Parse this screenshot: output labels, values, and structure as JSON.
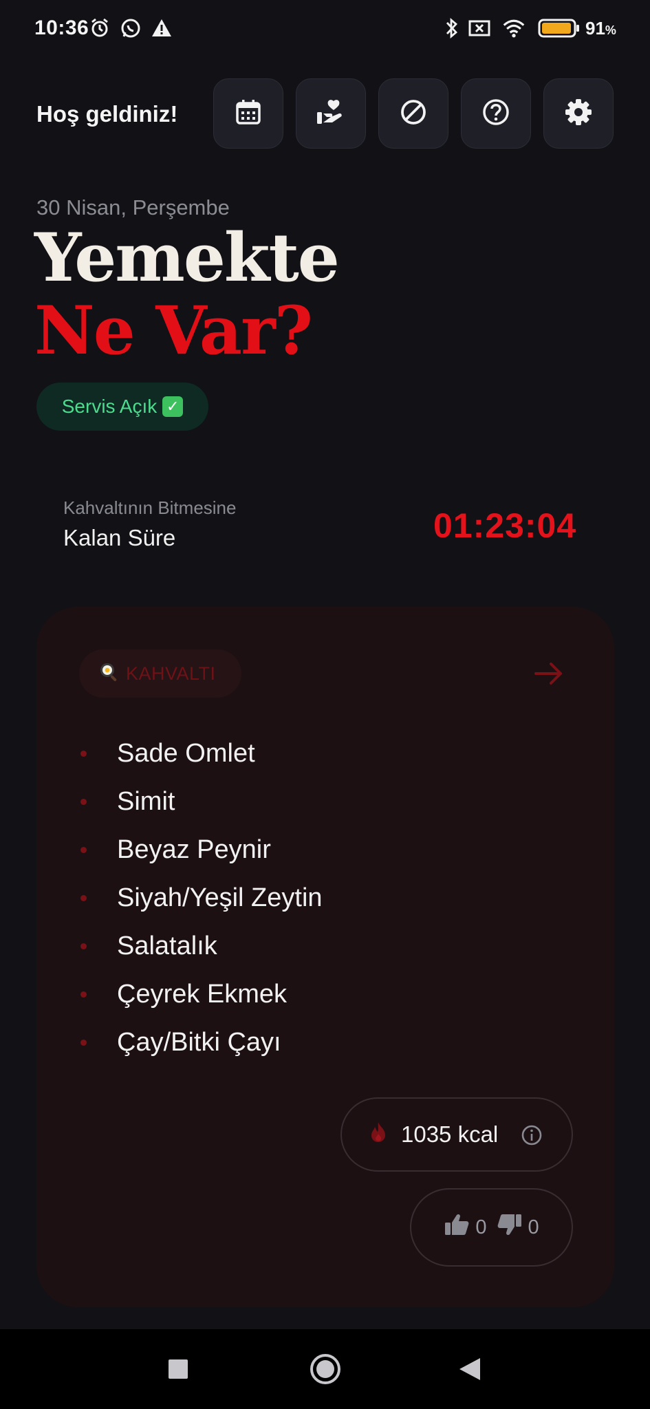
{
  "status_bar": {
    "time": "10:36",
    "battery_percent_label": "91",
    "battery_percent_sign": "%",
    "battery_level": 0.91,
    "icons": [
      "alarm-icon",
      "whatsapp-icon",
      "warning-icon",
      "bluetooth-icon",
      "no-sim-icon",
      "wifi-icon",
      "battery-icon"
    ]
  },
  "header": {
    "greeting": "Hoş geldiniz!",
    "buttons": [
      "calendar-icon",
      "donate-heart-icon",
      "block-icon",
      "help-icon",
      "settings-gear-icon"
    ]
  },
  "hero": {
    "date": "30 Nisan, Perşembe",
    "title_line1": "Yemekte",
    "title_line2": "Ne Var?",
    "service_status": "Servis Açık",
    "service_status_icon": "✓"
  },
  "countdown": {
    "label": "Kahvaltının Bitmesine",
    "sublabel": "Kalan Süre",
    "time": "01:23:04"
  },
  "meal": {
    "tag": "KAHVALTI",
    "tag_icon": "frying-pan-egg-icon",
    "items": [
      "Sade Omlet",
      "Simit",
      "Beyaz Peynir",
      "Siyah/Yeşil Zeytin",
      "Salatalık",
      "Çeyrek Ekmek",
      "Çay/Bitki Çayı"
    ],
    "calories": "1035 kcal",
    "likes": "0",
    "dislikes": "0"
  },
  "colors": {
    "background": "#111116",
    "accent_red": "#e20f17",
    "card_bg": "#1d1013",
    "status_green": "#4ddc8f"
  },
  "navigation": [
    "recents-square-icon",
    "home-circle-icon",
    "back-triangle-icon"
  ]
}
